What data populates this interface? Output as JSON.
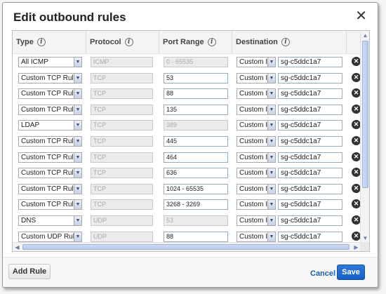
{
  "dialog": {
    "title": "Edit outbound rules",
    "close": "✕"
  },
  "columns": [
    {
      "label": "Type"
    },
    {
      "label": "Protocol"
    },
    {
      "label": "Port Range"
    },
    {
      "label": "Destination"
    }
  ],
  "info_glyph": "i",
  "rules": [
    {
      "type": "All ICMP",
      "protocol": "ICMP",
      "port": "0 - 65535",
      "port_editable": false,
      "dest_type": "Custom IP",
      "dest": "sg-c5ddc1a7"
    },
    {
      "type": "Custom TCP Rule",
      "protocol": "TCP",
      "port": "53",
      "port_editable": true,
      "dest_type": "Custom IP",
      "dest": "sg-c5ddc1a7"
    },
    {
      "type": "Custom TCP Rule",
      "protocol": "TCP",
      "port": "88",
      "port_editable": true,
      "dest_type": "Custom IP",
      "dest": "sg-c5ddc1a7"
    },
    {
      "type": "Custom TCP Rule",
      "protocol": "TCP",
      "port": "135",
      "port_editable": true,
      "dest_type": "Custom IP",
      "dest": "sg-c5ddc1a7"
    },
    {
      "type": "LDAP",
      "protocol": "TCP",
      "port": "389",
      "port_editable": false,
      "dest_type": "Custom IP",
      "dest": "sg-c5ddc1a7"
    },
    {
      "type": "Custom TCP Rule",
      "protocol": "TCP",
      "port": "445",
      "port_editable": true,
      "dest_type": "Custom IP",
      "dest": "sg-c5ddc1a7"
    },
    {
      "type": "Custom TCP Rule",
      "protocol": "TCP",
      "port": "464",
      "port_editable": true,
      "dest_type": "Custom IP",
      "dest": "sg-c5ddc1a7"
    },
    {
      "type": "Custom TCP Rule",
      "protocol": "TCP",
      "port": "636",
      "port_editable": true,
      "dest_type": "Custom IP",
      "dest": "sg-c5ddc1a7"
    },
    {
      "type": "Custom TCP Rule",
      "protocol": "TCP",
      "port": "1024 - 65535",
      "port_editable": true,
      "dest_type": "Custom IP",
      "dest": "sg-c5ddc1a7"
    },
    {
      "type": "Custom TCP Rule",
      "protocol": "TCP",
      "port": "3268 - 3269",
      "port_editable": true,
      "dest_type": "Custom IP",
      "dest": "sg-c5ddc1a7"
    },
    {
      "type": "DNS",
      "protocol": "UDP",
      "port": "53",
      "port_editable": false,
      "dest_type": "Custom IP",
      "dest": "sg-c5ddc1a7"
    },
    {
      "type": "Custom UDP Rule",
      "protocol": "UDP",
      "port": "88",
      "port_editable": true,
      "dest_type": "Custom IP",
      "dest": "sg-c5ddc1a7"
    }
  ],
  "footer": {
    "add_rule": "Add Rule",
    "cancel": "Cancel",
    "save": "Save"
  },
  "colors": {
    "save_bg": "#1a66c9",
    "cancel_link": "#1a5fb4"
  }
}
